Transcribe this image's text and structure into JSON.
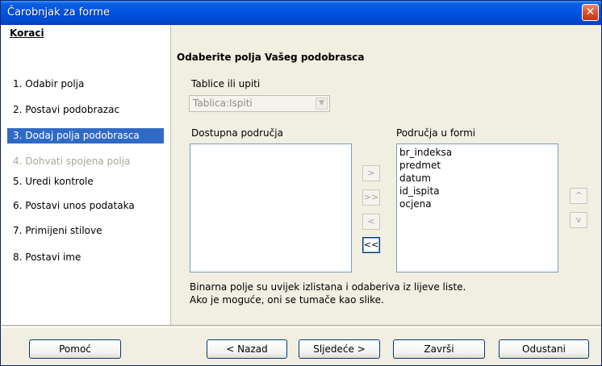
{
  "window": {
    "title": "Čarobnjak za forme",
    "close_glyph": "✕"
  },
  "sidebar": {
    "title": "Koraci",
    "steps": [
      {
        "label": "1.  Odabir polja",
        "state": "normal"
      },
      {
        "label": "2.  Postavi podobrazac",
        "state": "normal"
      },
      {
        "label": "3.  Dodaj polja podobrasca",
        "state": "active"
      },
      {
        "label": "4.  Dohvati spojena polja",
        "state": "disabled"
      },
      {
        "label": "5.  Uredi kontrole",
        "state": "normal"
      },
      {
        "label": "6.  Postavi unos podataka",
        "state": "normal"
      },
      {
        "label": "7.  Primijeni stilove",
        "state": "normal"
      },
      {
        "label": "8.  Postavi ime",
        "state": "normal"
      }
    ]
  },
  "main": {
    "heading": "Odaberite polja Vašeg podobrasca",
    "tables_label": "Tablice ili upiti",
    "tables_value": "Tablica:Ispiti",
    "available_label": "Dostupna područja",
    "form_fields_label": "Područja u formi",
    "form_fields": [
      "br_indeksa",
      "predmet",
      "datum",
      "id_ispita",
      "ocjena"
    ],
    "move_buttons": {
      "add_one": ">",
      "add_all": ">>",
      "remove_one": "<",
      "remove_all": "<<",
      "up": "^",
      "down": "v"
    },
    "info_line1": "Binarna polje su uvijek izlistana i odaberiva iz lijeve liste.",
    "info_line2": "Ako je moguće, oni se tumače kao slike."
  },
  "footer": {
    "help": "Pomoć",
    "back": "< Nazad",
    "next": "Sljedeće >",
    "finish": "Završi",
    "cancel": "Odustani"
  }
}
